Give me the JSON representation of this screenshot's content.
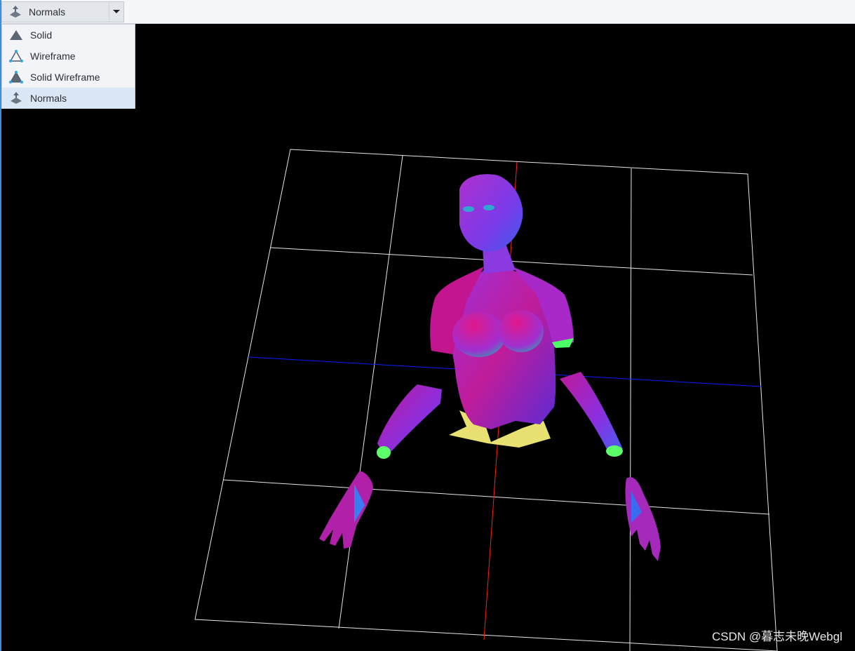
{
  "toolbar": {
    "combo": {
      "selected_label": "Normals",
      "icon": "normals-icon"
    }
  },
  "menu": {
    "items": [
      {
        "label": "Solid",
        "icon": "solid-triangle-icon"
      },
      {
        "label": "Wireframe",
        "icon": "wireframe-triangle-icon"
      },
      {
        "label": "Solid Wireframe",
        "icon": "solid-wireframe-triangle-icon"
      },
      {
        "label": "Normals",
        "icon": "normals-icon",
        "selected": true
      }
    ]
  },
  "scene": {
    "background": "#000000",
    "grid_color": "#ffffff",
    "x_axis_color": "#0000ff",
    "z_axis_color": "#ff0000",
    "model": "female-upper-body-normals-shaded"
  },
  "watermark": "CSDN @暮志未晚Webgl"
}
